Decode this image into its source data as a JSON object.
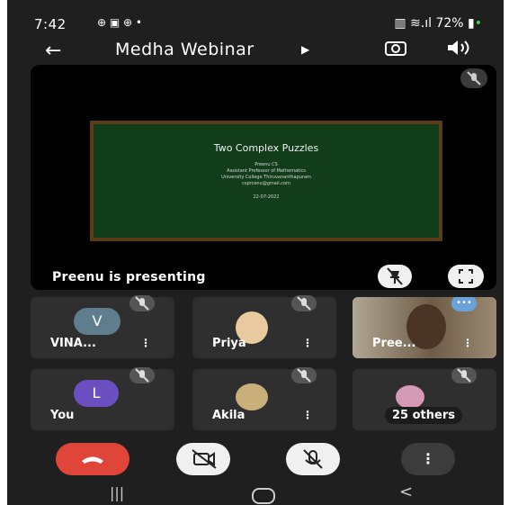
{
  "status": {
    "time": "7:42",
    "battery": "72%"
  },
  "appbar": {
    "title": "Medha Webinar"
  },
  "presentation": {
    "slide_title": "Two Complex Puzzles",
    "slide_author": "Preenu CS",
    "slide_role": "Assistant Professor of Mathematics",
    "slide_org": "University College Thiruvananthapuram",
    "slide_email": "csprcenu@gmail.com",
    "slide_date": "22-07-2022",
    "presenting_label": "Preenu is presenting"
  },
  "participants": [
    {
      "name": "VINA...",
      "initial": "V",
      "avatar_color": "#5f7d8c"
    },
    {
      "name": "Priya"
    },
    {
      "name": "Pree..."
    },
    {
      "name": "You",
      "initial": "L",
      "avatar_color": "#6b4ec0"
    },
    {
      "name": "Akila"
    },
    {
      "name": "25 others"
    }
  ],
  "colors": {
    "end_call": "#e0453a",
    "button_light": "#f0f0f0",
    "tile_bg": "#2f2f2f"
  }
}
